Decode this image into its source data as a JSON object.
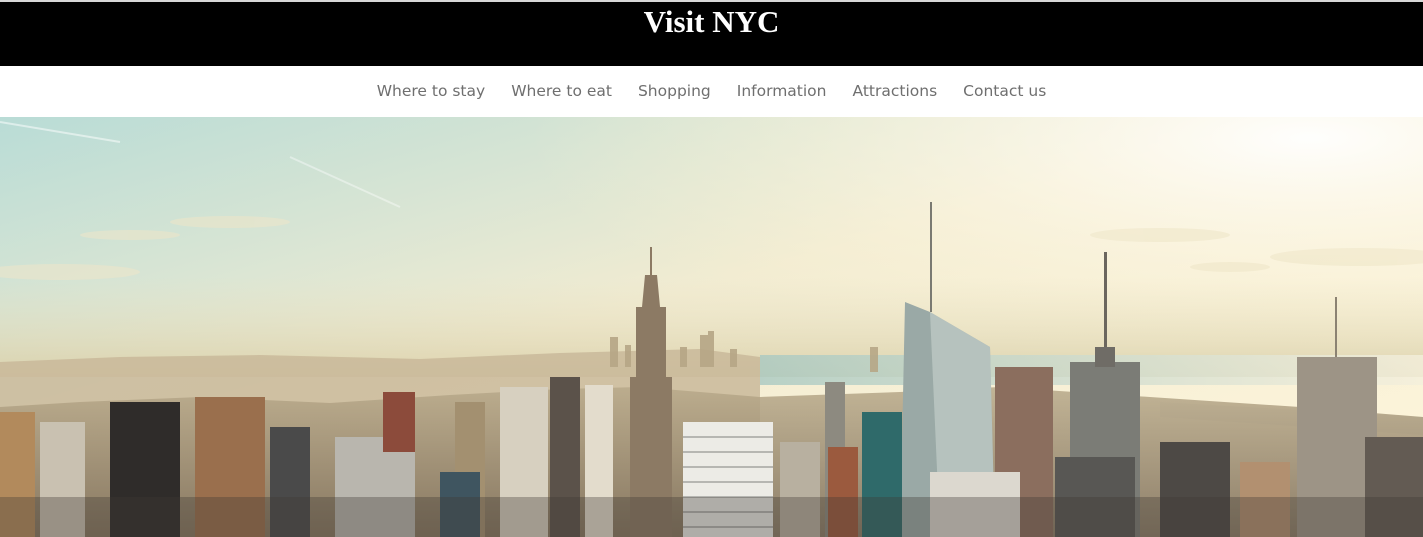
{
  "header": {
    "title": "Visit NYC",
    "background": "#000000",
    "title_color": "#ffffff"
  },
  "nav": {
    "items": [
      {
        "label": "Where to stay"
      },
      {
        "label": "Where to eat"
      },
      {
        "label": "Shopping"
      },
      {
        "label": "Information"
      },
      {
        "label": "Attractions"
      },
      {
        "label": "Contact us"
      }
    ],
    "text_color": "#6f6f6f"
  },
  "hero": {
    "subject": "New York City skyline photo"
  }
}
